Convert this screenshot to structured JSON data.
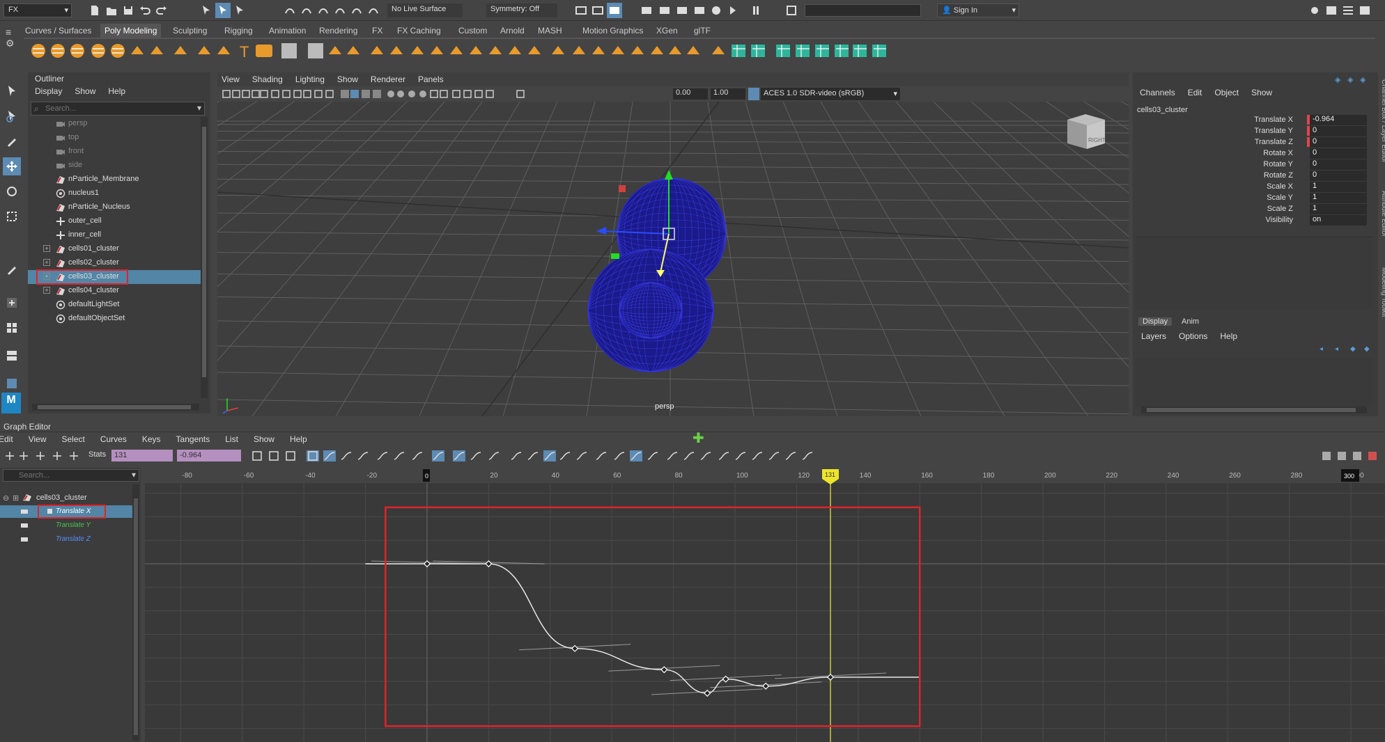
{
  "menuset": "FX",
  "status_line": {
    "live_surface": "No Live Surface",
    "symmetry": "Symmetry: Off",
    "sign_in": "Sign In"
  },
  "shelf_tabs": [
    "Curves / Surfaces",
    "Poly Modeling",
    "Sculpting",
    "Rigging",
    "Animation",
    "Rendering",
    "FX",
    "FX Caching",
    "Custom",
    "Arnold",
    "MASH",
    "Motion Graphics",
    "XGen",
    "glTF"
  ],
  "active_shelf": "Poly Modeling",
  "outliner": {
    "title": "Outliner",
    "menu": [
      "Display",
      "Show",
      "Help"
    ],
    "search_placeholder": "Search...",
    "items": [
      {
        "label": "persp",
        "dim": true,
        "expand": false,
        "icon": "camera-icon"
      },
      {
        "label": "top",
        "dim": true,
        "expand": false,
        "icon": "camera-icon"
      },
      {
        "label": "front",
        "dim": true,
        "expand": false,
        "icon": "camera-icon"
      },
      {
        "label": "side",
        "dim": true,
        "expand": false,
        "icon": "camera-icon"
      },
      {
        "label": "nParticle_Membrane",
        "dim": false,
        "expand": false,
        "icon": "nparticle-icon"
      },
      {
        "label": "nucleus1",
        "dim": false,
        "expand": false,
        "icon": "nucleus-icon"
      },
      {
        "label": "nParticle_Nucleus",
        "dim": false,
        "expand": false,
        "icon": "nparticle-icon"
      },
      {
        "label": "outer_cell",
        "dim": false,
        "expand": false,
        "icon": "locator-icon"
      },
      {
        "label": "inner_cell",
        "dim": false,
        "expand": false,
        "icon": "locator-icon"
      },
      {
        "label": "cells01_cluster",
        "dim": false,
        "expand": true,
        "icon": "cluster-icon"
      },
      {
        "label": "cells02_cluster",
        "dim": false,
        "expand": true,
        "icon": "cluster-icon"
      },
      {
        "label": "cells03_cluster",
        "dim": false,
        "expand": true,
        "icon": "cluster-icon",
        "selected": true
      },
      {
        "label": "cells04_cluster",
        "dim": false,
        "expand": true,
        "icon": "cluster-icon"
      },
      {
        "label": "defaultLightSet",
        "dim": false,
        "expand": false,
        "icon": "set-icon"
      },
      {
        "label": "defaultObjectSet",
        "dim": false,
        "expand": false,
        "icon": "set-icon"
      }
    ]
  },
  "viewport": {
    "menu": [
      "View",
      "Shading",
      "Lighting",
      "Show",
      "Renderer",
      "Panels"
    ],
    "field1": "0.00",
    "field2": "1.00",
    "color_mgmt": "ACES 1.0 SDR-video (sRGB)",
    "camera": "persp",
    "viewcube": "RIGHT"
  },
  "channel_box": {
    "menu": [
      "Channels",
      "Edit",
      "Object",
      "Show"
    ],
    "object": "cells03_cluster",
    "channels": [
      {
        "name": "Translate X",
        "value": "-0.964",
        "keyed": true
      },
      {
        "name": "Translate Y",
        "value": "0",
        "keyed": true
      },
      {
        "name": "Translate Z",
        "value": "0",
        "keyed": true
      },
      {
        "name": "Rotate X",
        "value": "0",
        "keyed": false
      },
      {
        "name": "Rotate Y",
        "value": "0",
        "keyed": false
      },
      {
        "name": "Rotate Z",
        "value": "0",
        "keyed": false
      },
      {
        "name": "Scale X",
        "value": "1",
        "keyed": false
      },
      {
        "name": "Scale Y",
        "value": "1",
        "keyed": false
      },
      {
        "name": "Scale Z",
        "value": "1",
        "keyed": false
      },
      {
        "name": "Visibility",
        "value": "on",
        "keyed": false
      }
    ],
    "layer_tabs": [
      "Display",
      "Anim"
    ],
    "layer_menu": [
      "Layers",
      "Options",
      "Help"
    ],
    "side_tabs": [
      "Channel Box / Layer Editor",
      "Attribute Editor",
      "Modeling Toolkit"
    ]
  },
  "graph_editor": {
    "title": "Graph Editor",
    "menu": [
      "Edit",
      "View",
      "Select",
      "Curves",
      "Keys",
      "Tangents",
      "List",
      "Show",
      "Help"
    ],
    "stats_label": "Stats",
    "stats_frame": "131",
    "stats_value": "-0.964",
    "search_placeholder": "Search...",
    "tree": {
      "node": "cells03_cluster",
      "curves": [
        {
          "label": "Translate X",
          "color": "#ff6a6a",
          "selected": true
        },
        {
          "label": "Translate Y",
          "color": "#4ec24e"
        },
        {
          "label": "Translate Z",
          "color": "#5a8cff"
        }
      ]
    },
    "frame_ticks": [
      "-80",
      "-60",
      "-40",
      "-20",
      "0",
      "20",
      "40",
      "60",
      "80",
      "100",
      "120",
      "140",
      "160",
      "180",
      "200",
      "220",
      "240",
      "260",
      "280",
      "300"
    ],
    "start_marker": "0",
    "current_frame": "131",
    "end_marker": "300",
    "value_ticks": [
      "0.6",
      "0.4",
      "0.2",
      "0",
      "-0.2",
      "-0.4",
      "-0.6",
      "-0.8",
      "-1",
      "-1.2",
      "-1.4"
    ]
  },
  "chart_data": {
    "type": "line",
    "xlabel": "",
    "ylabel": "",
    "series": [
      {
        "name": "Translate X",
        "points": [
          [
            -20,
            0
          ],
          [
            0,
            0
          ],
          [
            20,
            0
          ],
          [
            48,
            -0.72
          ],
          [
            77,
            -0.9
          ],
          [
            91,
            -1.1
          ],
          [
            97,
            -0.98
          ],
          [
            110,
            -1.04
          ],
          [
            131,
            -0.964
          ],
          [
            160,
            -0.964
          ]
        ]
      }
    ],
    "keys": [
      [
        0,
        0
      ],
      [
        20,
        0
      ],
      [
        48,
        -0.72
      ],
      [
        77,
        -0.9
      ],
      [
        91,
        -1.1
      ],
      [
        97,
        -0.98
      ],
      [
        110,
        -1.04
      ],
      [
        131,
        -0.964
      ]
    ],
    "xlim": [
      -80,
      300
    ],
    "ylim": [
      -1.45,
      0.65
    ],
    "current_frame": 131
  }
}
